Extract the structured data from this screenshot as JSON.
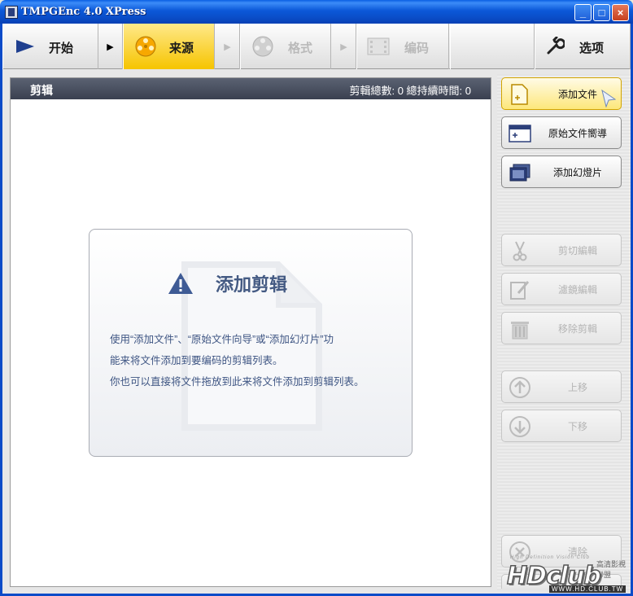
{
  "window": {
    "title": "TMPGEnc 4.0 XPress",
    "minimize": "_",
    "maximize": "□",
    "close": "×"
  },
  "nav": {
    "start": "开始",
    "source": "来源",
    "format": "格式",
    "encode": "编码",
    "options": "选项",
    "arrow": "▶"
  },
  "clips": {
    "title": "剪辑",
    "stats": "剪輯總數: 0    總持續時間: 0"
  },
  "notice": {
    "title": "添加剪辑",
    "line1": "使用“添加文件”、“原始文件向导”或“添加幻灯片”功",
    "line2": "能来将文件添加到要编码的剪辑列表。",
    "line3": "你也可以直接将文件拖放到此来将文件添加到剪辑列表。"
  },
  "side": {
    "add_file": "添加文件",
    "source_wizard": "原始文件嚮導",
    "add_slideshow": "添加幻燈片",
    "cut_edit": "剪切編輯",
    "filter_edit": "濾鏡編輯",
    "remove_clip": "移除剪輯",
    "move_up": "上移",
    "move_down": "下移",
    "clear": "清除"
  },
  "watermark": {
    "brand": "HDclub",
    "tagline": "High Definition Vision Club",
    "url": "WWW.HD.CLUB.TW",
    "cn": "高清影視聯盟"
  },
  "colors": {
    "active_step": "#f6c400",
    "header": "#3a4050",
    "notice_text": "#3e5583",
    "titlebar": "#0a4fcb"
  }
}
